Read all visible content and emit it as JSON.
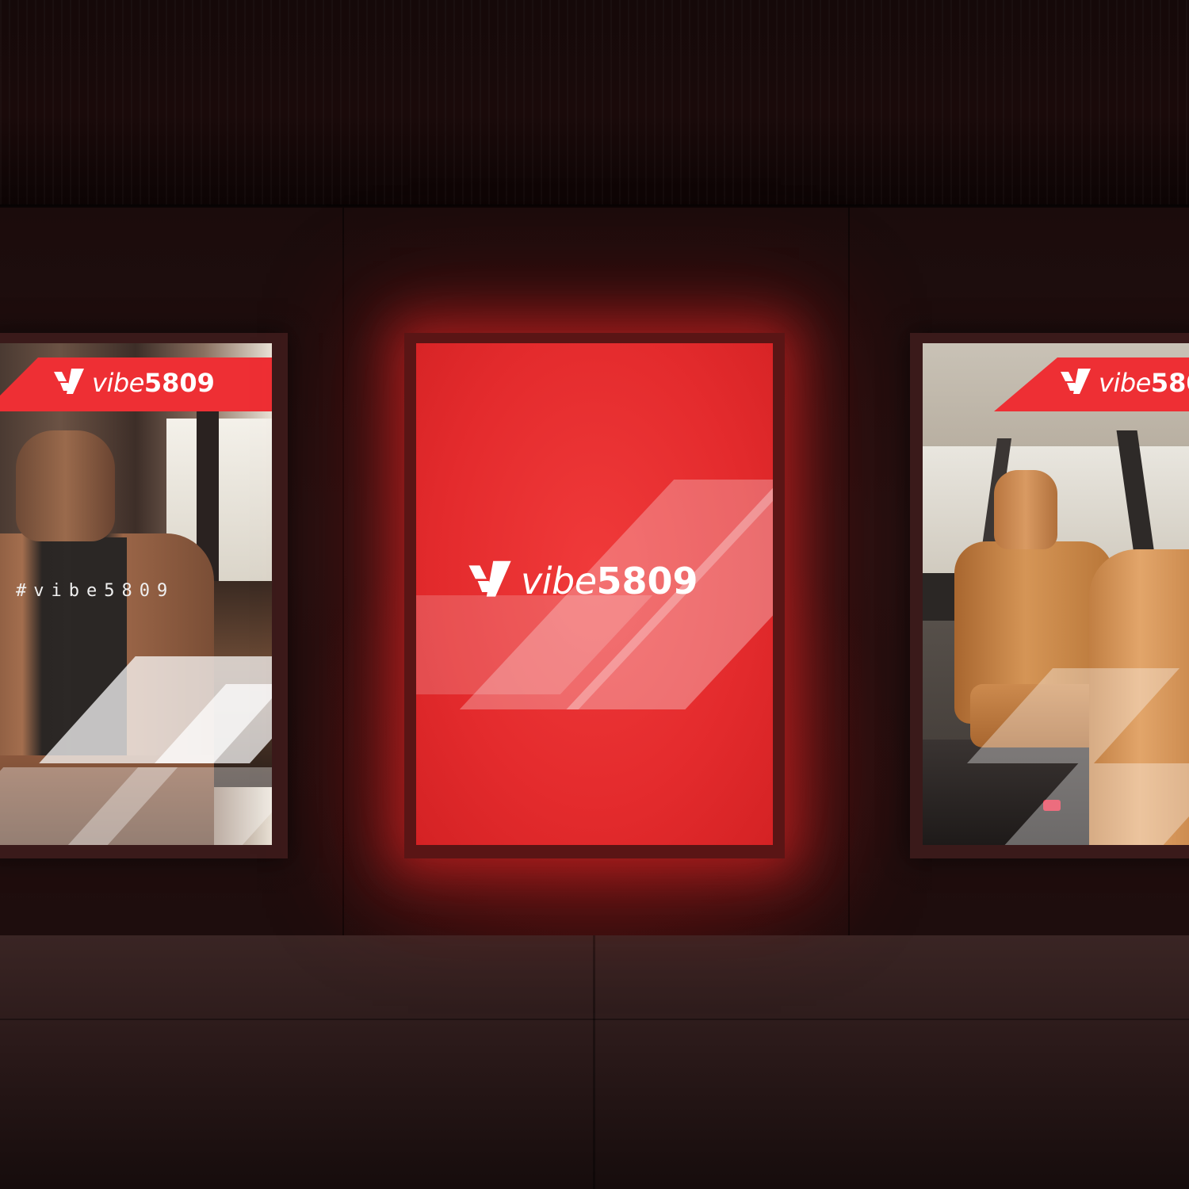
{
  "scene": {
    "description_free": true,
    "brand": {
      "name": "vibe",
      "number": "5809",
      "full": "vibe5809",
      "hashtag": "#vibe5809",
      "accent_color": "#ee2f34"
    },
    "panels": [
      {
        "position": "left",
        "content": "car-seat-photo",
        "banner_text": "vibe5809",
        "hashtag": "#vibe5809"
      },
      {
        "position": "center",
        "content": "logo",
        "banner_text": "vibe5809"
      },
      {
        "position": "right",
        "content": "suv-interior-photo",
        "banner_text": "vibe58"
      }
    ],
    "colors": {
      "wall": "#241010",
      "ceiling": "#150909",
      "floor": "#2a1919",
      "glow": "#e42b2d"
    },
    "icons": [
      "vibe-logo-mark-icon"
    ]
  }
}
